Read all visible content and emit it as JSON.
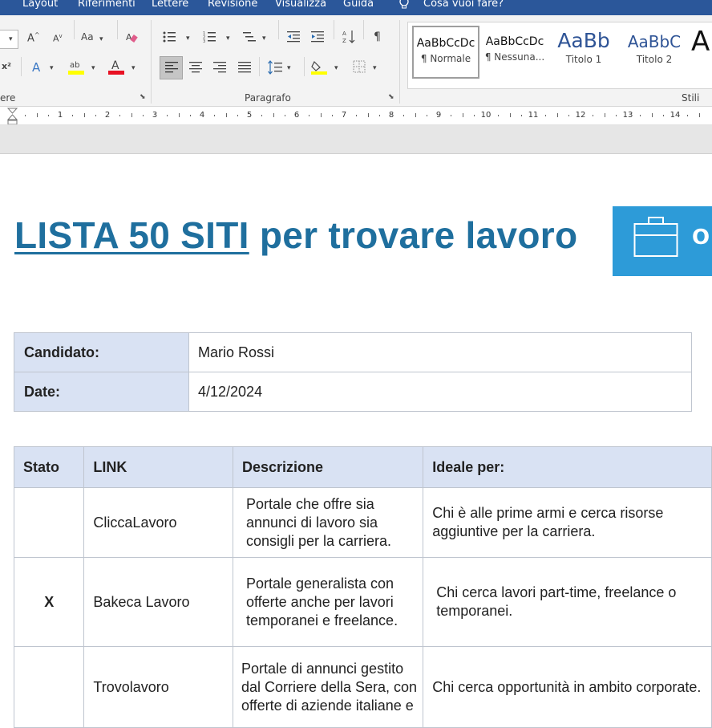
{
  "menu": [
    "Layout",
    "Riferimenti",
    "Lettere",
    "Revisione",
    "Visualizza",
    "Guida"
  ],
  "tell_me": "Cosa vuoi fare?",
  "ribbon": {
    "font_group_label": "ere",
    "paragraph_group_label": "Paragrafo",
    "styles_group_label": "Stili",
    "styles": [
      {
        "preview": "AaBbCcDc",
        "name": "¶ Normale"
      },
      {
        "preview": "AaBbCcDc",
        "name": "¶ Nessuna..."
      },
      {
        "preview": "AaBb",
        "name": "Titolo 1"
      },
      {
        "preview": "AaBbC",
        "name": "Titolo 2"
      },
      {
        "preview": "A",
        "name": ""
      }
    ]
  },
  "ruler_numbers": [
    "1",
    "2",
    "3",
    "4",
    "5",
    "6",
    "7",
    "8",
    "9",
    "10",
    "11",
    "12",
    "13",
    "14"
  ],
  "document": {
    "title_link": "LISTA 50 SITI",
    "title_rest": " per trovare lavoro",
    "banner_text": "O",
    "info": [
      {
        "label": "Candidato:",
        "value": "Mario Rossi"
      },
      {
        "label": "Date:",
        "value": "4/12/2024"
      }
    ],
    "columns": [
      "Stato",
      "LINK",
      "Descrizione",
      "Ideale per:"
    ],
    "rows": [
      {
        "stato": "",
        "link": "CliccaLavoro",
        "descrizione": "Portale che offre sia annunci di lavoro sia consigli per la carriera.",
        "ideale": "Chi è alle prime armi e cerca risorse aggiuntive per la carriera."
      },
      {
        "stato": "X",
        "link": "Bakeca Lavoro",
        "descrizione": "Portale generalista con offerte anche per lavori temporanei e freelance.",
        "ideale": "Chi cerca lavori part-time, freelance o temporanei."
      },
      {
        "stato": "",
        "link": "Trovolavoro",
        "descrizione": "Portale di annunci gestito dal Corriere della Sera, con offerte di aziende italiane e",
        "ideale": "Chi cerca opportunità in ambito corporate."
      }
    ]
  },
  "colors": {
    "menubar": "#2b579a",
    "title": "#1f6f9e",
    "header_fill": "#d9e2f3",
    "banner": "#2d9bd8"
  }
}
